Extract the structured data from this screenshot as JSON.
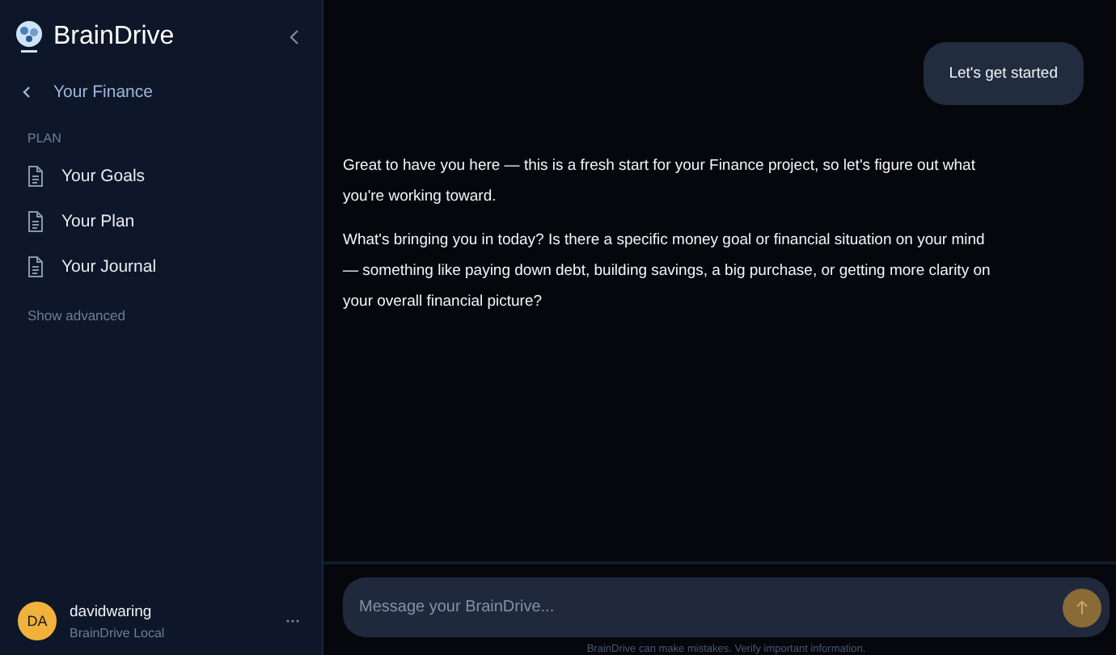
{
  "sidebar": {
    "brand": "BrainDrive",
    "back_label": "Your Finance",
    "section": "PLAN",
    "items": [
      {
        "label": "Your Goals"
      },
      {
        "label": "Your Plan"
      },
      {
        "label": "Your Journal"
      }
    ],
    "show_advanced": "Show advanced",
    "user": {
      "initials": "DA",
      "name": "davidwaring",
      "subtitle": "BrainDrive Local"
    }
  },
  "messages": [
    {
      "kind": "user",
      "paragraphs": [
        "Let's get started"
      ]
    },
    {
      "kind": "assistant",
      "paragraphs": [
        "Great to have you here — this is a fresh start for your Finance project, so let's figure out what you're working toward.",
        "What's bringing you in today? Is there a specific money goal or financial situation on your mind — something like paying down debt, building savings, a big purchase, or getting more clarity on your overall financial picture?"
      ]
    }
  ],
  "composer": {
    "placeholder": "Message your BrainDrive...",
    "send_disabled": true
  },
  "disclaimer": "BrainDrive can make mistakes. Verify important information."
}
